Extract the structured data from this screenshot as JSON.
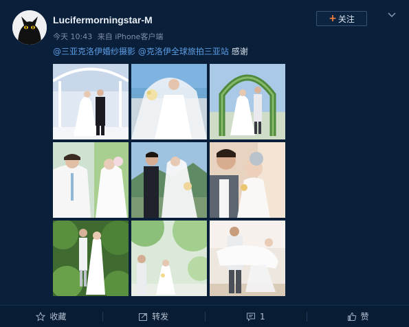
{
  "header": {
    "username": "Lucifermorningstar-M",
    "time": "今天 10:43",
    "source": "来自 iPhone客户端",
    "follow_label": "关注"
  },
  "post": {
    "mention_1": "@三亚克洛伊婚纱摄影",
    "mention_2": "@克洛伊全球旅拍三亚站",
    "text": "感谢"
  },
  "photos": [
    {
      "name": "photo-1",
      "scene": "white gazebo, couple in suit and veil"
    },
    {
      "name": "photo-2",
      "scene": "bride with bouquet, sea behind"
    },
    {
      "name": "photo-3",
      "scene": "couple under green floral arch"
    },
    {
      "name": "photo-4",
      "scene": "groom in white suit, bride behind"
    },
    {
      "name": "photo-5",
      "scene": "couple facing each other, hills"
    },
    {
      "name": "photo-6",
      "scene": "couple close-up, warm tone"
    },
    {
      "name": "photo-7",
      "scene": "couple in tropical greenery"
    },
    {
      "name": "photo-8",
      "scene": "couple under trees, light"
    },
    {
      "name": "photo-9",
      "scene": "groom carrying bride on beach"
    }
  ],
  "actions": {
    "favorite_label": "收藏",
    "repost_label": "转发",
    "comment_count": "1",
    "like_label": "赞"
  },
  "colors": {
    "background": "#0a1f3a",
    "mention": "#5b9ee6",
    "follow_plus": "#ff8140"
  }
}
